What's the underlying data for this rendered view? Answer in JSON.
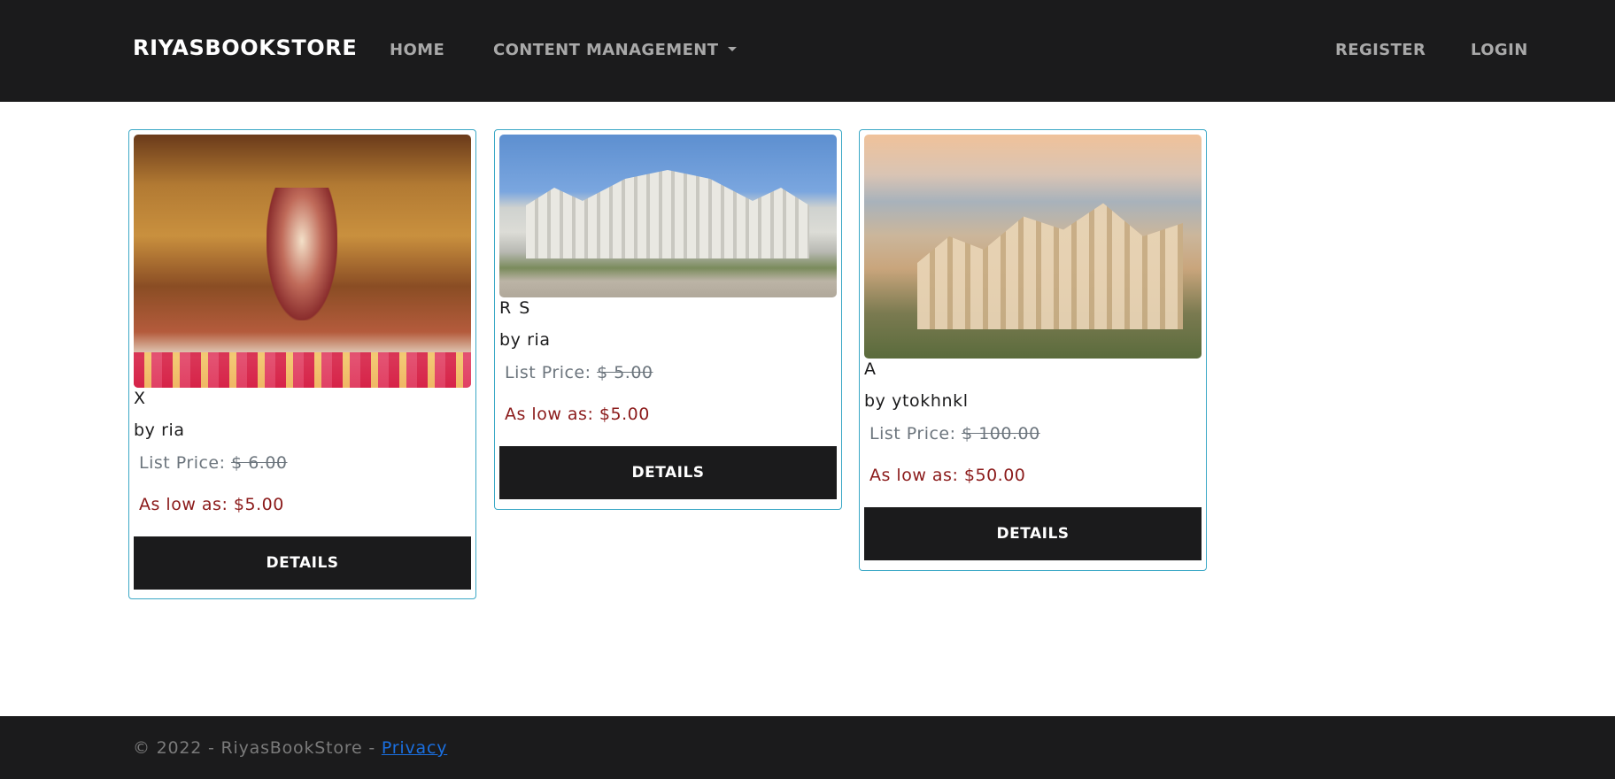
{
  "navbar": {
    "brand": "RIYASBOOKSTORE",
    "home": "HOME",
    "content_management": "CONTENT MANAGEMENT",
    "register": "REGISTER",
    "login": "LOGIN"
  },
  "products": [
    {
      "title": "X",
      "author": "by ria",
      "list_price_label": "List Price:",
      "list_price": "$ 6.00",
      "low_price": "As low as: $5.00",
      "button": "DETAILS"
    },
    {
      "title": "R S",
      "author": "by ria",
      "list_price_label": "List Price:",
      "list_price": "$ 5.00",
      "low_price": "As low as: $5.00",
      "button": "DETAILS"
    },
    {
      "title": "A",
      "author": "by ytokhnkl",
      "list_price_label": "List Price:",
      "list_price": "$ 100.00",
      "low_price": "As low as: $50.00",
      "button": "DETAILS"
    }
  ],
  "footer": {
    "copyright": "© 2022 - RiyasBookStore - ",
    "privacy": "Privacy"
  },
  "colors": {
    "navbar_bg": "#1b1b1c",
    "card_border": "#3ba8c6",
    "low_price": "#8b1a1a",
    "link": "#1a6fe0"
  }
}
